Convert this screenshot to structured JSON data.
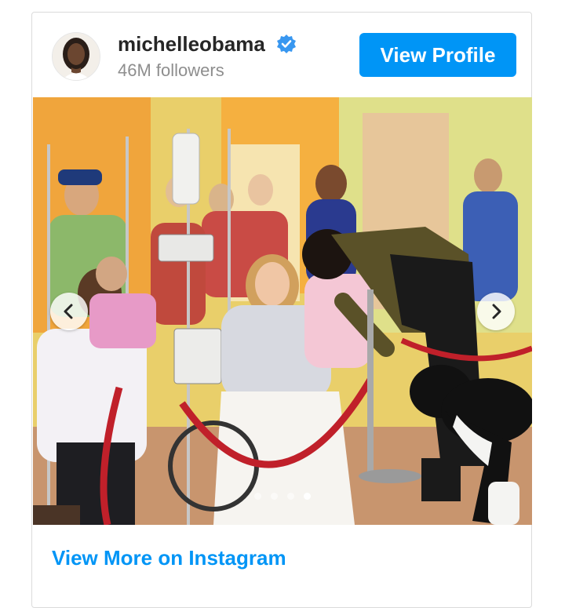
{
  "profile": {
    "username": "michelleobama",
    "verified_icon": "verified-badge-icon",
    "followers": "46M followers",
    "view_profile_label": "View Profile",
    "avatar_icon": "profile-avatar"
  },
  "post": {
    "photo_icon": "hospital-visit-photo",
    "prev_icon": "chevron-left-icon",
    "next_icon": "chevron-right-icon",
    "carousel_count": 4,
    "active_index": 3
  },
  "footer": {
    "view_more_label": "View More on Instagram"
  },
  "colors": {
    "accent": "#0095f6",
    "username": "#262626",
    "muted": "#8e8e8e",
    "border": "#dbdbdb"
  }
}
